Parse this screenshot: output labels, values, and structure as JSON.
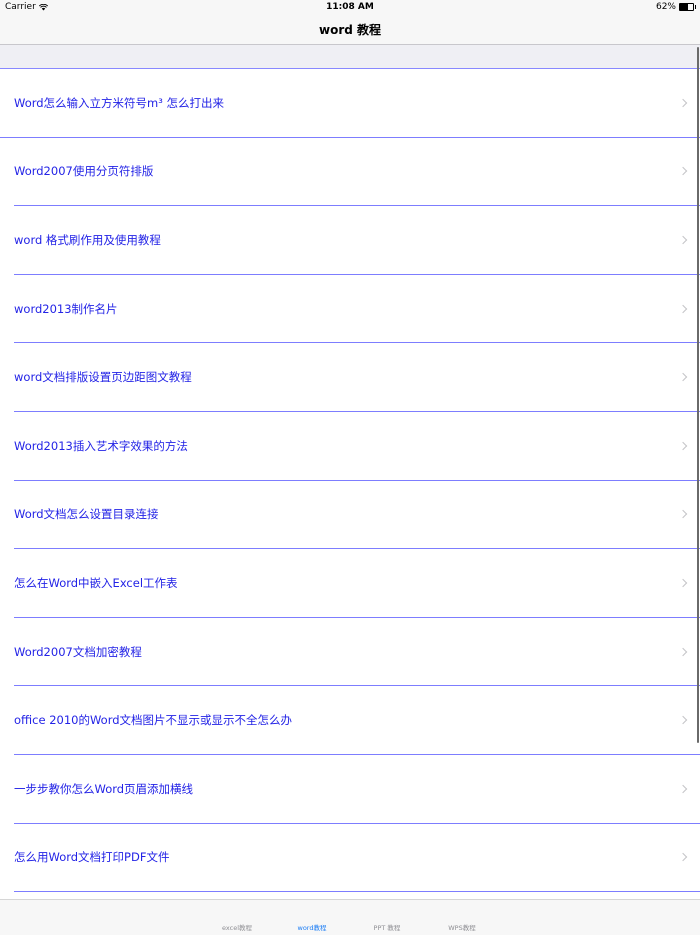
{
  "status": {
    "carrier": "Carrier",
    "time": "11:08 AM",
    "battery_percent_label": "62%",
    "battery_level": 0.62
  },
  "nav": {
    "title": "word 教程"
  },
  "articles": [
    "Word怎么输入立方米符号m³ 怎么打出来",
    "Word2007使用分页符排版",
    "word 格式刷作用及使用教程",
    "word2013制作名片",
    "word文档排版设置页边距图文教程",
    "Word2013插入艺术字效果的方法",
    "Word文档怎么设置目录连接",
    "怎么在Word中嵌入Excel工作表",
    "Word2007文档加密教程",
    "office 2010的Word文档图片不显示或显示不全怎么办",
    "一步步教你怎么Word页眉添加横线",
    "怎么用Word文档打印PDF文件"
  ],
  "tabs": [
    {
      "label": "excel教程",
      "active": false
    },
    {
      "label": "word教程",
      "active": true
    },
    {
      "label": "PPT 教程",
      "active": false
    },
    {
      "label": "WPS教程",
      "active": false
    }
  ],
  "colors": {
    "link": "#2323e6",
    "separator": "#7d7dff",
    "tab_active": "#1a7cf5",
    "tab_inactive": "#8e8e93"
  }
}
